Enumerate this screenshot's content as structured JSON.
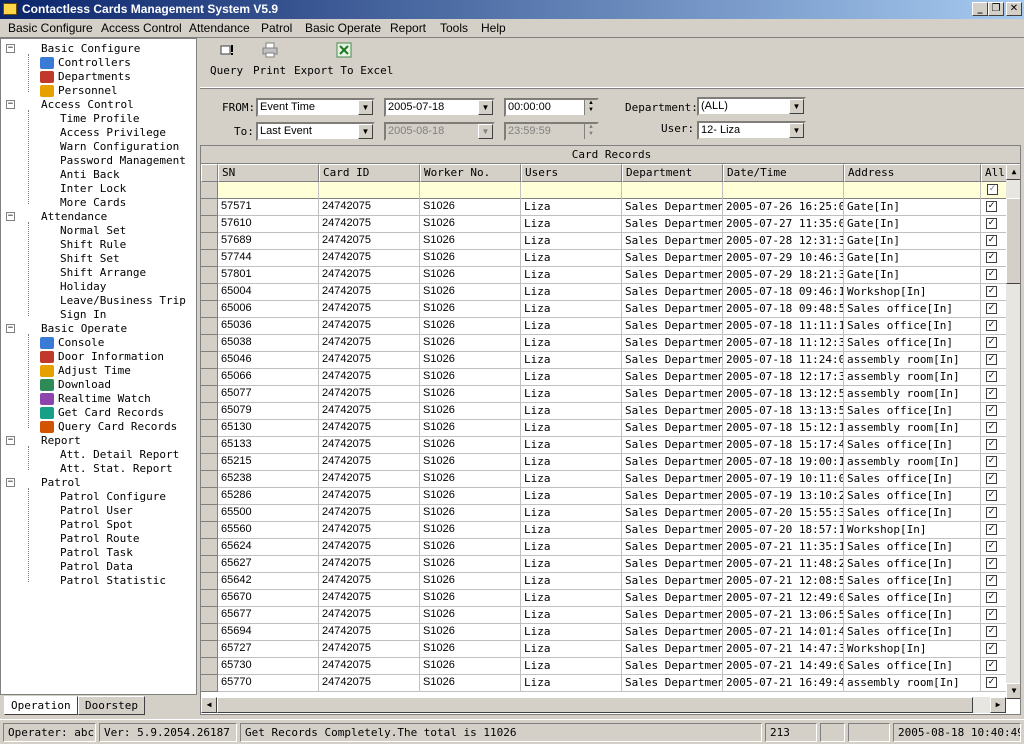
{
  "window": {
    "title": "Contactless Cards Management System  V5.9"
  },
  "menu": [
    "Basic Configure",
    "Access Control",
    "Attendance",
    "Patrol",
    "Basic Operate",
    "Report",
    "Tools",
    "Help"
  ],
  "tree": [
    {
      "label": "Basic Configure",
      "children": [
        "Controllers",
        "Departments",
        "Personnel"
      ]
    },
    {
      "label": "Access Control",
      "children": [
        "Time Profile",
        "Access Privilege",
        "Warn Configuration",
        "Password Management",
        "Anti Back",
        "Inter Lock",
        "More Cards"
      ]
    },
    {
      "label": "Attendance",
      "children": [
        "Normal Set",
        "Shift Rule",
        "Shift Set",
        "Shift Arrange",
        "Holiday",
        "Leave/Business Trip",
        "Sign In"
      ]
    },
    {
      "label": "Basic Operate",
      "children": [
        "Console",
        "Door Information",
        "Adjust Time",
        "Download",
        "Realtime Watch",
        "Get Card Records",
        "Query Card Records"
      ]
    },
    {
      "label": "Report",
      "children": [
        "Att. Detail Report",
        "Att. Stat. Report"
      ]
    },
    {
      "label": "Patrol",
      "children": [
        "Patrol Configure",
        "Patrol User",
        "Patrol Spot",
        "Patrol Route",
        "Patrol Task",
        "Patrol Data",
        "Patrol Statistic"
      ]
    }
  ],
  "left_tabs": [
    "Operation",
    "Doorstep"
  ],
  "toolbar": {
    "query": "Query",
    "print": "Print",
    "export": "Export To Excel"
  },
  "filter": {
    "from_label": "FROM:",
    "to_label": "To:",
    "from_type": "Event Time",
    "to_type": "Last Event",
    "from_date": "2005-07-18",
    "to_date": "2005-08-18",
    "from_time": "00:00:00",
    "to_time": "23:59:59",
    "department_label": "Department:",
    "department": "(ALL)",
    "user_label": "User:",
    "user": "12- Liza"
  },
  "grid": {
    "caption": "Card Records",
    "columns": [
      "SN",
      "Card ID",
      "Worker No.",
      "Users",
      "Department",
      "Date/Time",
      "Address",
      "All"
    ],
    "rows": [
      [
        "57571",
        "24742075",
        "S1026",
        "Liza",
        "Sales Departmen",
        "2005-07-26 16:25:0",
        "Gate[In]"
      ],
      [
        "57610",
        "24742075",
        "S1026",
        "Liza",
        "Sales Departmen",
        "2005-07-27 11:35:0",
        "Gate[In]"
      ],
      [
        "57689",
        "24742075",
        "S1026",
        "Liza",
        "Sales Departmen",
        "2005-07-28 12:31:3",
        "Gate[In]"
      ],
      [
        "57744",
        "24742075",
        "S1026",
        "Liza",
        "Sales Departmen",
        "2005-07-29 10:46:3",
        "Gate[In]"
      ],
      [
        "57801",
        "24742075",
        "S1026",
        "Liza",
        "Sales Departmen",
        "2005-07-29 18:21:3",
        "Gate[In]"
      ],
      [
        "65004",
        "24742075",
        "S1026",
        "Liza",
        "Sales Departmen",
        "2005-07-18 09:46:1",
        "Workshop[In]"
      ],
      [
        "65006",
        "24742075",
        "S1026",
        "Liza",
        "Sales Departmen",
        "2005-07-18 09:48:5",
        "Sales office[In]"
      ],
      [
        "65036",
        "24742075",
        "S1026",
        "Liza",
        "Sales Departmen",
        "2005-07-18 11:11:1",
        "Sales office[In]"
      ],
      [
        "65038",
        "24742075",
        "S1026",
        "Liza",
        "Sales Departmen",
        "2005-07-18 11:12:3",
        "Sales office[In]"
      ],
      [
        "65046",
        "24742075",
        "S1026",
        "Liza",
        "Sales Departmen",
        "2005-07-18 11:24:0",
        "assembly room[In]"
      ],
      [
        "65066",
        "24742075",
        "S1026",
        "Liza",
        "Sales Departmen",
        "2005-07-18 12:17:3",
        "assembly room[In]"
      ],
      [
        "65077",
        "24742075",
        "S1026",
        "Liza",
        "Sales Departmen",
        "2005-07-18 13:12:5",
        "assembly room[In]"
      ],
      [
        "65079",
        "24742075",
        "S1026",
        "Liza",
        "Sales Departmen",
        "2005-07-18 13:13:5",
        "Sales office[In]"
      ],
      [
        "65130",
        "24742075",
        "S1026",
        "Liza",
        "Sales Departmen",
        "2005-07-18 15:12:1",
        "assembly room[In]"
      ],
      [
        "65133",
        "24742075",
        "S1026",
        "Liza",
        "Sales Departmen",
        "2005-07-18 15:17:4",
        "Sales office[In]"
      ],
      [
        "65215",
        "24742075",
        "S1026",
        "Liza",
        "Sales Departmen",
        "2005-07-18 19:00:1",
        "assembly room[In]"
      ],
      [
        "65238",
        "24742075",
        "S1026",
        "Liza",
        "Sales Departmen",
        "2005-07-19 10:11:0",
        "Sales office[In]"
      ],
      [
        "65286",
        "24742075",
        "S1026",
        "Liza",
        "Sales Departmen",
        "2005-07-19 13:10:2",
        "Sales office[In]"
      ],
      [
        "65500",
        "24742075",
        "S1026",
        "Liza",
        "Sales Departmen",
        "2005-07-20 15:55:3",
        "Sales office[In]"
      ],
      [
        "65560",
        "24742075",
        "S1026",
        "Liza",
        "Sales Departmen",
        "2005-07-20 18:57:1",
        "Workshop[In]"
      ],
      [
        "65624",
        "24742075",
        "S1026",
        "Liza",
        "Sales Departmen",
        "2005-07-21 11:35:1",
        "Sales office[In]"
      ],
      [
        "65627",
        "24742075",
        "S1026",
        "Liza",
        "Sales Departmen",
        "2005-07-21 11:48:2",
        "Sales office[In]"
      ],
      [
        "65642",
        "24742075",
        "S1026",
        "Liza",
        "Sales Departmen",
        "2005-07-21 12:08:5",
        "Sales office[In]"
      ],
      [
        "65670",
        "24742075",
        "S1026",
        "Liza",
        "Sales Departmen",
        "2005-07-21 12:49:0",
        "Sales office[In]"
      ],
      [
        "65677",
        "24742075",
        "S1026",
        "Liza",
        "Sales Departmen",
        "2005-07-21 13:06:5",
        "Sales office[In]"
      ],
      [
        "65694",
        "24742075",
        "S1026",
        "Liza",
        "Sales Departmen",
        "2005-07-21 14:01:4",
        "Sales office[In]"
      ],
      [
        "65727",
        "24742075",
        "S1026",
        "Liza",
        "Sales Departmen",
        "2005-07-21 14:47:3",
        "Workshop[In]"
      ],
      [
        "65730",
        "24742075",
        "S1026",
        "Liza",
        "Sales Departmen",
        "2005-07-21 14:49:0",
        "Sales office[In]"
      ],
      [
        "65770",
        "24742075",
        "S1026",
        "Liza",
        "Sales Departmen",
        "2005-07-21 16:49:4",
        "assembly room[In]"
      ]
    ]
  },
  "status": {
    "operator": "Operater: abc",
    "version": "Ver: 5.9.2054.26187",
    "message": "Get Records Completely.The total is  11026",
    "count": "213",
    "datetime": "2005-08-18 10:40:49"
  }
}
